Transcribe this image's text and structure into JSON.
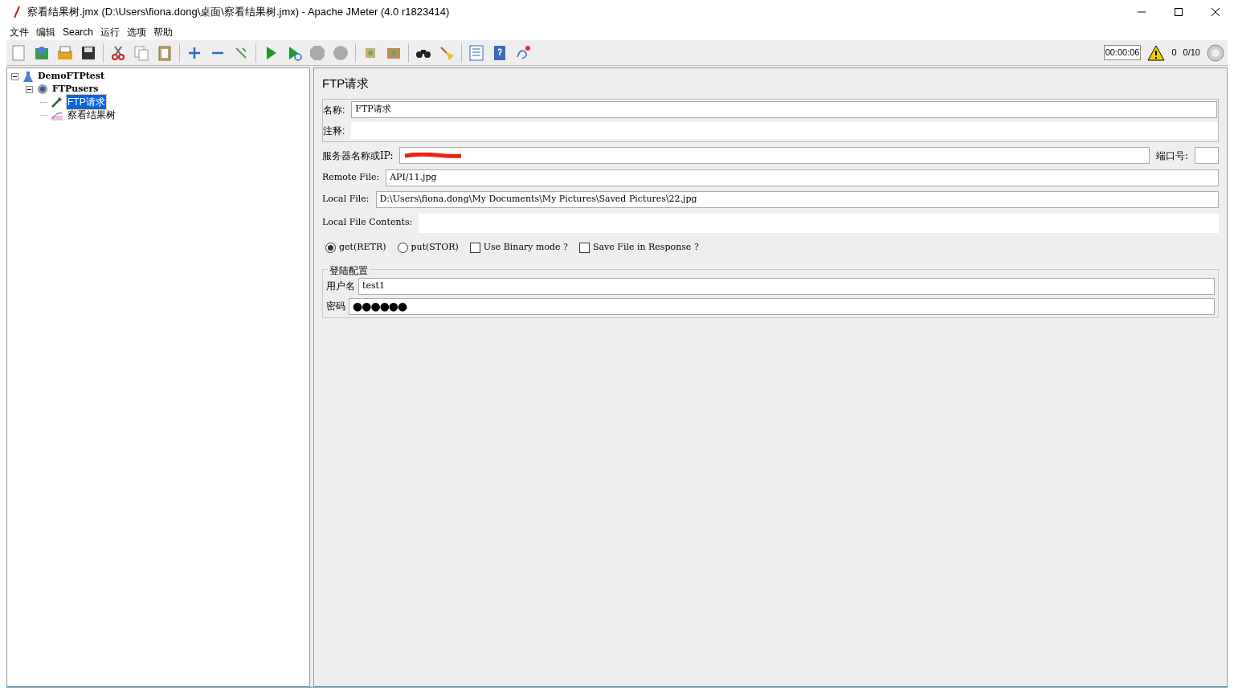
{
  "window": {
    "title": "察看结果树.jmx (D:\\Users\\fiona.dong\\桌面\\察看结果树.jmx) - Apache JMeter (4.0 r1823414)"
  },
  "menu": [
    "文件",
    "编辑",
    "Search",
    "运行",
    "选项",
    "帮助"
  ],
  "status": {
    "timer": "00:00:06",
    "warnings": "0",
    "threads": "0/10"
  },
  "tree": [
    {
      "label": "DemoFTPtest",
      "kind": "plan",
      "selected": false,
      "expanded": true,
      "children": [
        {
          "label": "FTPusers",
          "kind": "group",
          "selected": false,
          "expanded": true,
          "children": [
            {
              "label": "FTP请求",
              "kind": "sampler",
              "selected": true
            },
            {
              "label": "察看结果树",
              "kind": "listener",
              "selected": false
            }
          ]
        }
      ]
    }
  ],
  "panel": {
    "title": "FTP请求",
    "name_label": "名称:",
    "name_value": "FTP请求",
    "comment_label": "注释:",
    "server_label": "服务器名称或IP:",
    "port_label": "端口号:",
    "remote_label": "Remote File:",
    "remote_value": "API/11.jpg",
    "local_label": "Local File:",
    "local_value": "D:\\Users\\fiona.dong\\My Documents\\My Pictures\\Saved Pictures\\22.jpg",
    "contents_label": "Local File Contents:",
    "options": [
      {
        "kind": "radio",
        "label": "get(RETR)",
        "selected": true
      },
      {
        "kind": "radio",
        "label": "put(STOR)",
        "selected": false
      },
      {
        "kind": "checkbox",
        "label": "Use Binary mode ?",
        "checked": false
      },
      {
        "kind": "checkbox",
        "label": "Save File in Response ?",
        "checked": false
      }
    ],
    "login": {
      "legend": "登陆配置",
      "user_label": "用户名",
      "user_value": "test1",
      "pass_label": "密码",
      "pass_value": "●●●●●●"
    }
  }
}
